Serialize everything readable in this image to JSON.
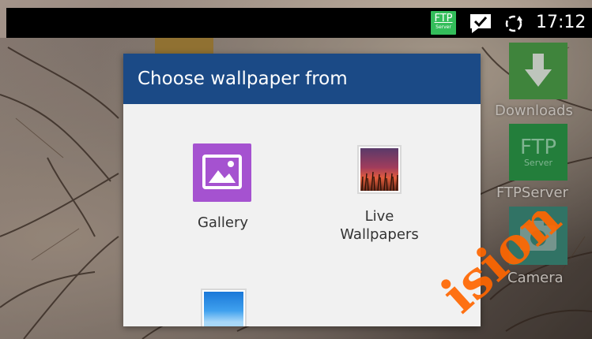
{
  "status_bar": {
    "ftp_icon_text": "FTP",
    "ftp_icon_subtext": "Server",
    "message_icon": "chat-check-icon",
    "sync_icon": "sync-icon",
    "time": "17:12"
  },
  "home_screen": {
    "downloads_label": "Downloads",
    "ftp_tile_text": "FTP",
    "ftp_tile_subtext": "Server",
    "ftpserver_label": "FTPServer",
    "camera_label": "Camera"
  },
  "dialog": {
    "title": "Choose wallpaper from",
    "options": [
      {
        "label": "Gallery",
        "icon": "gallery-icon"
      },
      {
        "label_line1": "Live",
        "label_line2": "Wallpapers",
        "icon": "live-wallpapers-icon"
      },
      {
        "label": "",
        "icon": "wallpapers-icon"
      }
    ]
  },
  "watermark": {
    "text": "ision"
  },
  "colors": {
    "dialog_header": "#1b4a86",
    "dialog_body": "#f1f1f1",
    "ftp_green": "#33bd5a",
    "gallery_purple": "#a552d0",
    "watermark_orange": "#ff6600"
  }
}
